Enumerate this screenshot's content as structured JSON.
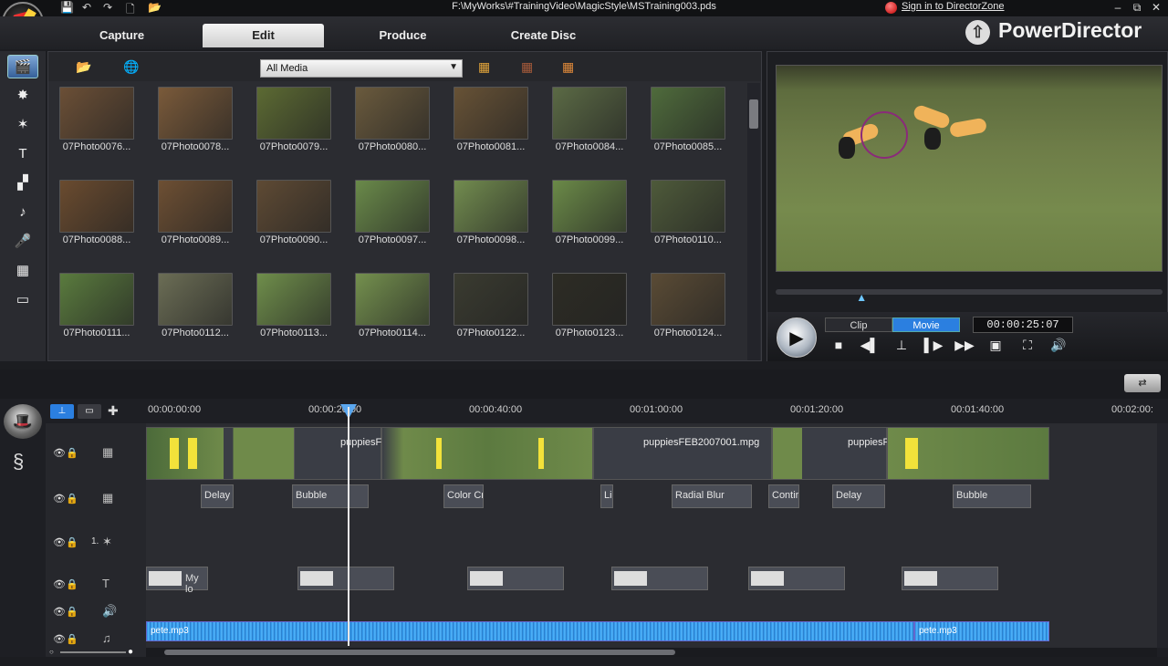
{
  "window": {
    "path": "F:\\MyWorks\\#TrainingVideo\\MagicStyle\\MSTraining003.pds",
    "signin_link": "Sign in to DirectorZone",
    "brand": "PowerDirector"
  },
  "main_tabs": [
    {
      "label": "Capture"
    },
    {
      "label": "Edit",
      "active": true
    },
    {
      "label": "Produce"
    },
    {
      "label": "Create Disc"
    }
  ],
  "library": {
    "filter_selected": "All Media",
    "items": [
      {
        "label": "07Photo0076...",
        "color": "#6b4f36"
      },
      {
        "label": "07Photo0078...",
        "color": "#7a5a3a"
      },
      {
        "label": "07Photo0079...",
        "color": "#5c6a33"
      },
      {
        "label": "07Photo0080...",
        "color": "#6a5a3d"
      },
      {
        "label": "07Photo0081...",
        "color": "#675236"
      },
      {
        "label": "07Photo0084...",
        "color": "#5b6a45"
      },
      {
        "label": "07Photo0085...",
        "color": "#4f6b3c"
      },
      {
        "label": "07Photo0088...",
        "color": "#6a4b2f"
      },
      {
        "label": "07Photo0089...",
        "color": "#6d4f33"
      },
      {
        "label": "07Photo0090...",
        "color": "#5e4a34"
      },
      {
        "label": "07Photo0097...",
        "color": "#6a8a4a"
      },
      {
        "label": "07Photo0098...",
        "color": "#728c4f"
      },
      {
        "label": "07Photo0099...",
        "color": "#6b8a48"
      },
      {
        "label": "07Photo0110...",
        "color": "#4e5a3a"
      },
      {
        "label": "07Photo0111...",
        "color": "#5a7b3e"
      },
      {
        "label": "07Photo0112...",
        "color": "#6b6d55"
      },
      {
        "label": "07Photo0113...",
        "color": "#6f8e4b"
      },
      {
        "label": "07Photo0114...",
        "color": "#74904e"
      },
      {
        "label": "07Photo0122...",
        "color": "#3a3b30"
      },
      {
        "label": "07Photo0123...",
        "color": "#2d2c24"
      },
      {
        "label": "07Photo0124...",
        "color": "#5a4b35"
      }
    ]
  },
  "preview": {
    "mode_clip": "Clip",
    "mode_movie": "Movie",
    "timecode": "00:00:25:07",
    "playhead_fraction": 0.22
  },
  "timeline": {
    "ruler": [
      "00:00:00:00",
      "00:00:20:00",
      "00:00:40:00",
      "00:01:00:00",
      "00:01:20:00",
      "00:01:40:00",
      "00:02:00:"
    ],
    "video_clip_labels": [
      "puppiesF",
      "puppiesFEB2007001.mpg",
      "puppiesF"
    ],
    "fx_clips": [
      "Delay",
      "Bubble",
      "Color Cra",
      "Lig",
      "Radial Blur",
      "Contir",
      "Delay",
      "Bubble"
    ],
    "pip_track_number": "1.",
    "title_clip_label": "My lo",
    "audio_clips": [
      "pete.mp3",
      "pete.mp3"
    ]
  },
  "colors": {
    "accent": "#3a8ee6",
    "audio": "#2a8ee0",
    "marker_yellow": "#f2e23a"
  }
}
